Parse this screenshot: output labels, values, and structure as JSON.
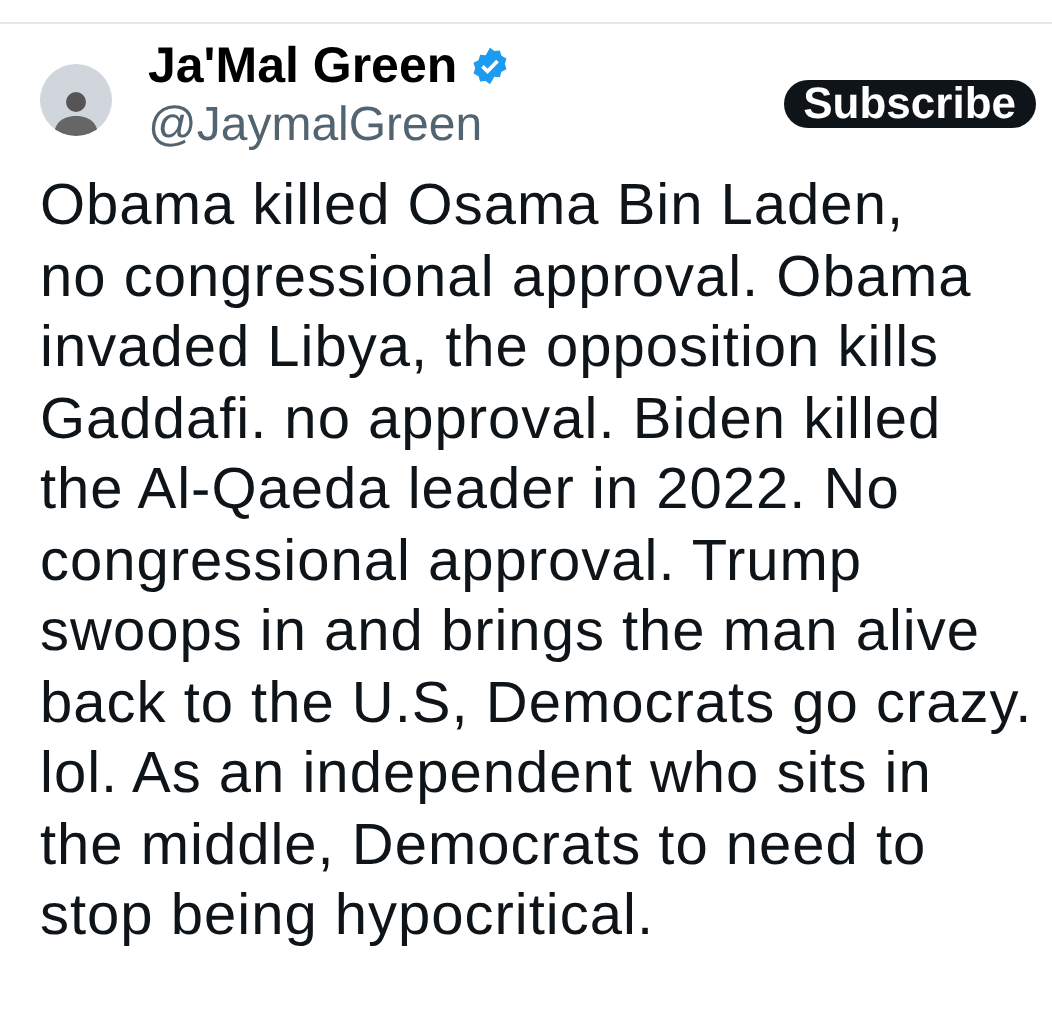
{
  "author": {
    "name": "Ja'Mal Green",
    "verified": true,
    "handle": "@JaymalGreen"
  },
  "subscribe_button": {
    "label": "Subscribe"
  },
  "post": {
    "lines": [
      "Obama killed Osama Bin Laden,",
      "no congressional approval. Obama",
      "invaded Libya, the opposition kills",
      "Gaddafi. no approval. Biden killed",
      "the Al-Qaeda leader in 2022. No",
      "congressional approval. Trump",
      "swoops in and brings the man alive",
      "back to the U.S, Democrats go crazy.",
      "lol. As an independent who sits in",
      "the middle, Democrats to need to",
      "stop being hypocritical."
    ]
  }
}
